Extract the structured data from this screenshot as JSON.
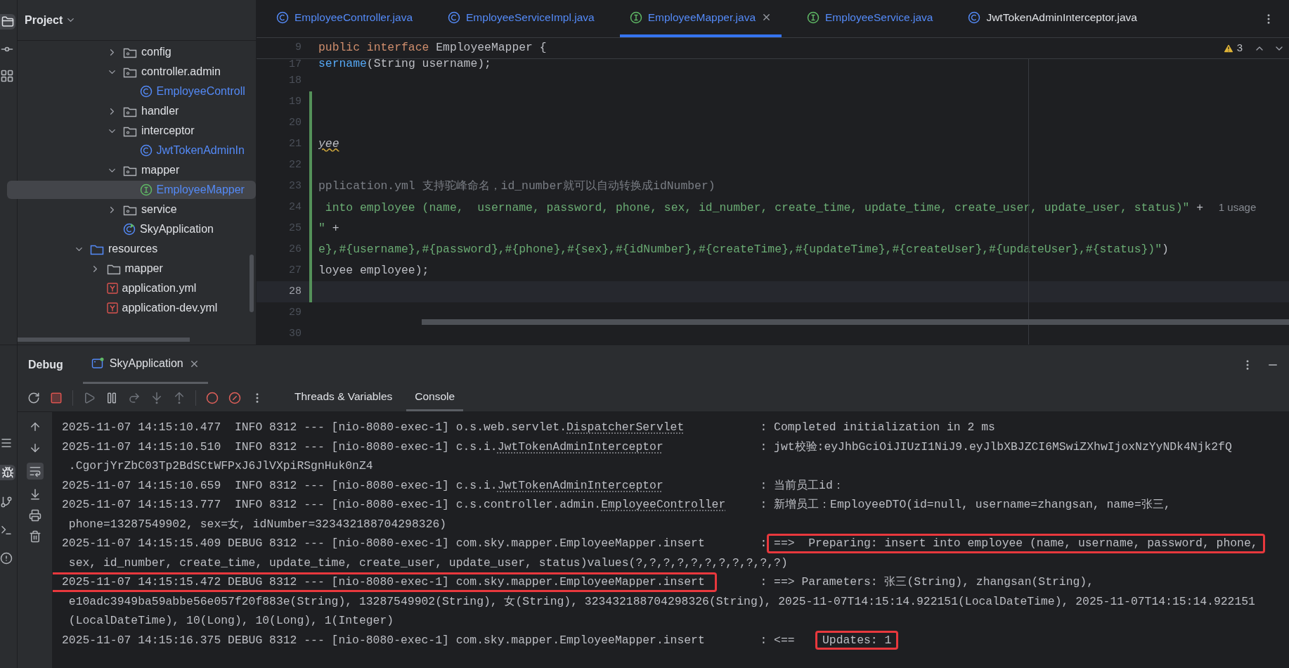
{
  "project_panel": {
    "title": "Project"
  },
  "project_tree": {
    "package_items": [
      {
        "label": "config",
        "kind": "package",
        "expanded": false,
        "selected": false
      },
      {
        "label": "controller.admin",
        "kind": "package",
        "expanded": true,
        "selected": false,
        "children": [
          {
            "label": "EmployeeControll",
            "kind": "class",
            "selected": false
          }
        ]
      },
      {
        "label": "handler",
        "kind": "package",
        "expanded": false,
        "selected": false
      },
      {
        "label": "interceptor",
        "kind": "package",
        "expanded": true,
        "selected": false,
        "children": [
          {
            "label": "JwtTokenAdminIn",
            "kind": "class",
            "selected": false
          }
        ]
      },
      {
        "label": "mapper",
        "kind": "package",
        "expanded": true,
        "selected": false,
        "children": [
          {
            "label": "EmployeeMapper",
            "kind": "interface",
            "selected": true
          }
        ]
      },
      {
        "label": "service",
        "kind": "package",
        "expanded": false,
        "selected": false
      },
      {
        "label": "SkyApplication",
        "kind": "app",
        "selected": false
      }
    ],
    "resources": {
      "label": "resources",
      "kind": "source_folder",
      "expanded": true,
      "selected": false,
      "children": [
        {
          "label": "mapper",
          "kind": "folder",
          "expanded": false,
          "selected": false
        },
        {
          "label": "application.yml",
          "kind": "yaml",
          "selected": false
        },
        {
          "label": "application-dev.yml",
          "kind": "yaml",
          "selected": false
        }
      ]
    }
  },
  "editor_tabs": [
    {
      "label": "EmployeeController.java",
      "kind": "class",
      "color": "#548af7",
      "selected": false
    },
    {
      "label": "EmployeeServiceImpl.java",
      "kind": "class",
      "color": "#548af7",
      "selected": false
    },
    {
      "label": "EmployeeMapper.java",
      "kind": "interface",
      "color": "#548af7",
      "selected": true
    },
    {
      "label": "EmployeeService.java",
      "kind": "interface",
      "color": "#548af7",
      "selected": false
    },
    {
      "label": "JwtTokenAdminInterceptor.java",
      "kind": "class",
      "color": "#dfe1e5",
      "selected": false
    }
  ],
  "warnings": {
    "count": "3"
  },
  "editor": {
    "sticky_line": {
      "number": "9",
      "segments": [
        {
          "text": "public interface ",
          "kind": "keyword"
        },
        {
          "text": "EmployeeMapper {",
          "kind": "plain"
        }
      ]
    },
    "lines": [
      {
        "number": "17",
        "changed": false,
        "current": false,
        "segments": [
          {
            "text": "sername",
            "kind": "method"
          },
          {
            "text": "(String username);",
            "kind": "plain"
          }
        ]
      },
      {
        "number": "18",
        "changed": false,
        "current": false
      },
      {
        "number": "19",
        "changed": true,
        "current": false
      },
      {
        "number": "20",
        "changed": true,
        "current": false
      },
      {
        "number": "21",
        "changed": true,
        "current": false,
        "segments": [
          {
            "text": "yee",
            "kind": "warn"
          }
        ]
      },
      {
        "number": "22",
        "changed": true,
        "current": false
      },
      {
        "number": "23",
        "changed": true,
        "current": false,
        "segments": [
          {
            "text": "pplication.yml 支持驼峰命名，id_number就可以自动转换成idNumber)",
            "kind": "comment"
          }
        ]
      },
      {
        "number": "24",
        "changed": true,
        "current": false,
        "segments": [
          {
            "text": " into employee (name,  username, password, phone, sex, id_number, create_time, update_time, create_user, update_user, status)\"",
            "kind": "string"
          },
          {
            "text": " + ",
            "kind": "plain"
          },
          {
            "text": "1 usage",
            "kind": "inlay"
          }
        ]
      },
      {
        "number": "25",
        "changed": true,
        "current": false,
        "segments": [
          {
            "text": "\"",
            "kind": "string"
          },
          {
            "text": " +",
            "kind": "plain"
          }
        ]
      },
      {
        "number": "26",
        "changed": true,
        "current": false,
        "segments": [
          {
            "text": "e},#{username},#{password},#{phone},#{sex},#{idNumber},#{createTime},#{updateTime},#{createUser},#{updateUser},#{status})\"",
            "kind": "string"
          },
          {
            "text": ")",
            "kind": "plain"
          }
        ]
      },
      {
        "number": "27",
        "changed": true,
        "current": false,
        "segments": [
          {
            "text": "loyee employee);",
            "kind": "plain"
          }
        ]
      },
      {
        "number": "28",
        "changed": true,
        "current": true
      },
      {
        "number": "29",
        "changed": false,
        "current": false
      },
      {
        "number": "30",
        "changed": false,
        "current": false
      }
    ]
  },
  "debug_panel": {
    "title": "Debug",
    "run_tab": "SkyApplication",
    "tabs": [
      {
        "label": "Threads & Variables",
        "selected": false
      },
      {
        "label": "Console",
        "selected": true
      }
    ]
  },
  "console": {
    "soft_wrap": true,
    "entries": [
      {
        "head": "2025-11-07 14:15:10.477  INFO 8312 --- [nio-8080-exec-1] o.s.web.servlet.",
        "link": "DispatcherServlet",
        "head_boxed": false,
        "separator": ":",
        "message": "Completed initialization in 2 ms"
      },
      {
        "head": "2025-11-07 14:15:10.510  INFO 8312 --- [nio-8080-exec-1] c.s.i.",
        "link": "JwtTokenAdminInterceptor",
        "head_boxed": false,
        "separator": ":",
        "message": "jwt校验:eyJhbGciOiJIUzI1NiJ9.eyJlbXBJZCI6MSwiZXhwIjoxNzYyNDk4Njk2fQ",
        "continuation": [
          ".CgorjYrZbC03Tp2BdSCtWFPxJ6JlVXpiRSgnHuk0nZ4"
        ]
      },
      {
        "head": "2025-11-07 14:15:10.659  INFO 8312 --- [nio-8080-exec-1] c.s.i.",
        "link": "JwtTokenAdminInterceptor",
        "head_boxed": false,
        "separator": ":",
        "message": "当前员工id："
      },
      {
        "head": "2025-11-07 14:15:13.777  INFO 8312 --- [nio-8080-exec-1] c.s.controller.admin.",
        "link": "EmployeeController",
        "head_boxed": false,
        "separator": ":",
        "message": "新增员工：EmployeeDTO(id=null, username=zhangsan, name=张三,",
        "continuation": [
          "phone=13287549902, sex=女, idNumber=323432188704298326)"
        ]
      },
      {
        "head": "2025-11-07 14:15:15.409 DEBUG 8312 --- [nio-8080-exec-1] com.sky.mapper.EmployeeMapper.insert",
        "head_boxed": false,
        "separator": ":",
        "boxed_message": "==>  Preparing: insert into employee (name, username, password, phone,",
        "continuation": [
          "sex, id_number, create_time, update_time, create_user, update_user, status)values(?,?,?,?,?,?,?,?,?,?,?)"
        ]
      },
      {
        "head": "2025-11-07 14:15:15.472 DEBUG 8312 --- [nio-8080-exec-1] com.sky.mapper.EmployeeMapper.insert",
        "head_boxed": true,
        "separator": ":",
        "message": "==> Parameters: 张三(String), zhangsan(String),",
        "continuation": [
          "e10adc3949ba59abbe56e057f20f883e(String), 13287549902(String), 女(String), 323432188704298326(String), 2025-11-07T14:15:14.922151(LocalDateTime), 2025-11-07T14:15:14.922151",
          "(LocalDateTime), 10(Long), 10(Long), 1(Integer)"
        ]
      },
      {
        "head": "2025-11-07 14:15:16.375 DEBUG 8312 --- [nio-8080-exec-1] com.sky.mapper.EmployeeMapper.insert",
        "head_boxed": false,
        "separator": ":",
        "message": "<==",
        "boxed_message": "Updates: 1"
      }
    ]
  }
}
